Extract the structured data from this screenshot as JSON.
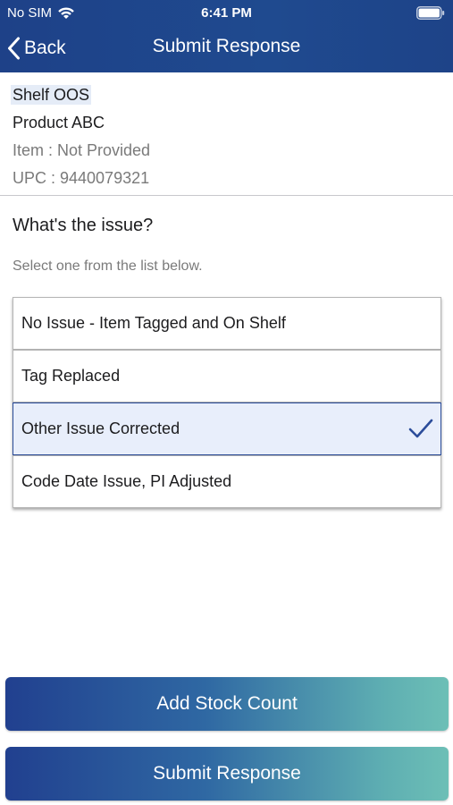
{
  "status": {
    "carrier": "No SIM",
    "time": "6:41 PM"
  },
  "nav": {
    "back_label": "Back",
    "title": "Submit Response"
  },
  "info": {
    "category": "Shelf OOS",
    "product": "Product ABC",
    "item": "Item : Not Provided",
    "upc": "UPC : 9440079321"
  },
  "question": {
    "title": "What's the issue?",
    "hint": "Select one from the list below."
  },
  "options": [
    {
      "label": "No Issue - Item Tagged and On Shelf",
      "selected": false
    },
    {
      "label": "Tag Replaced",
      "selected": false
    },
    {
      "label": "Other Issue Corrected",
      "selected": true
    },
    {
      "label": "Code Date Issue, PI Adjusted",
      "selected": false
    }
  ],
  "buttons": {
    "add_stock_count": "Add Stock Count",
    "submit_response": "Submit Response"
  },
  "colors": {
    "nav_bar": "#1f4a8f",
    "accent": "#2b4c9a",
    "selected_bg": "#e8eefb",
    "button_start": "#21408f",
    "button_end": "#6dbfb6"
  },
  "icons": {
    "wifi": "wifi-icon",
    "battery": "battery-icon",
    "back": "chevron-left-icon",
    "check": "checkmark-icon"
  }
}
